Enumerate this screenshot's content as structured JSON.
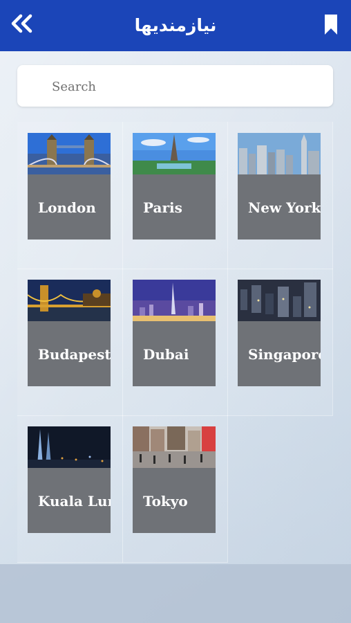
{
  "header": {
    "title": "نیازمندیها",
    "back_icon": "double-chevron-left-icon",
    "bookmark_icon": "bookmark-icon"
  },
  "search": {
    "placeholder": "Search"
  },
  "cities": [
    {
      "label": "London"
    },
    {
      "label": "Paris"
    },
    {
      "label": "New York"
    },
    {
      "label": "Budapest"
    },
    {
      "label": "Dubai"
    },
    {
      "label": "Singapore"
    },
    {
      "label": "Kuala Lumpur"
    },
    {
      "label": "Tokyo"
    }
  ],
  "colors": {
    "header": "#1b45b8",
    "card": "#6f7277"
  }
}
